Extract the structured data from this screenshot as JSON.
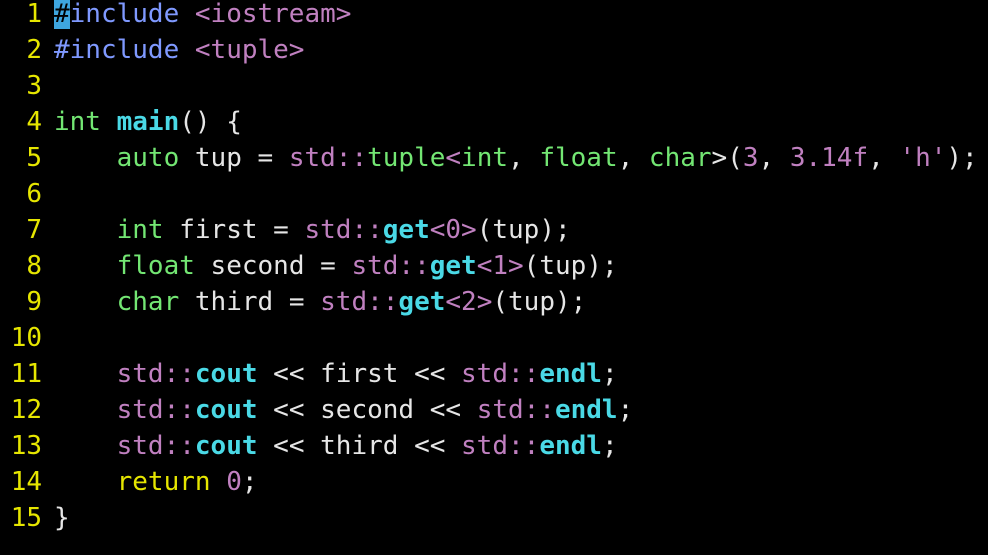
{
  "colors": {
    "background": "#000000",
    "line_number": "#e6e600",
    "text": "#e6e6e6",
    "preproc": "#7f99ff",
    "type": "#73e673",
    "keyword": "#e6e600",
    "func": "#4ad9e6",
    "namespace": "#c080c0",
    "string": "#c080c0",
    "number": "#c080c0",
    "cursor": "#3ea6df"
  },
  "editor": {
    "lines": [
      {
        "num": "1",
        "tokens": [
          {
            "t": "#",
            "k": "cursor"
          },
          {
            "t": "include",
            "k": "preproc"
          },
          {
            "t": " ",
            "k": "text"
          },
          {
            "t": "<iostream>",
            "k": "string"
          }
        ]
      },
      {
        "num": "2",
        "tokens": [
          {
            "t": "#include",
            "k": "preproc"
          },
          {
            "t": " ",
            "k": "text"
          },
          {
            "t": "<tuple>",
            "k": "string"
          }
        ]
      },
      {
        "num": "3",
        "tokens": []
      },
      {
        "num": "4",
        "tokens": [
          {
            "t": "int",
            "k": "type"
          },
          {
            "t": " ",
            "k": "text"
          },
          {
            "t": "main",
            "k": "func"
          },
          {
            "t": "() {",
            "k": "text"
          }
        ]
      },
      {
        "num": "5",
        "tokens": [
          {
            "t": "    ",
            "k": "text"
          },
          {
            "t": "auto",
            "k": "type"
          },
          {
            "t": " tup = ",
            "k": "text"
          },
          {
            "t": "std",
            "k": "namespace"
          },
          {
            "t": "::",
            "k": "namespace"
          },
          {
            "t": "tuple",
            "k": "type"
          },
          {
            "t": "<",
            "k": "namespace"
          },
          {
            "t": "int",
            "k": "type"
          },
          {
            "t": ", ",
            "k": "text"
          },
          {
            "t": "float",
            "k": "type"
          },
          {
            "t": ", ",
            "k": "text"
          },
          {
            "t": "char",
            "k": "type"
          },
          {
            "t": ">(",
            "k": "text"
          },
          {
            "t": "3",
            "k": "number"
          },
          {
            "t": ", ",
            "k": "text"
          },
          {
            "t": "3.14f",
            "k": "number"
          },
          {
            "t": ", ",
            "k": "text"
          },
          {
            "t": "'h'",
            "k": "string"
          },
          {
            "t": ");",
            "k": "text"
          }
        ]
      },
      {
        "num": "6",
        "tokens": []
      },
      {
        "num": "7",
        "tokens": [
          {
            "t": "    ",
            "k": "text"
          },
          {
            "t": "int",
            "k": "type"
          },
          {
            "t": " first = ",
            "k": "text"
          },
          {
            "t": "std",
            "k": "namespace"
          },
          {
            "t": "::",
            "k": "namespace"
          },
          {
            "t": "get",
            "k": "func"
          },
          {
            "t": "<",
            "k": "namespace"
          },
          {
            "t": "0",
            "k": "number"
          },
          {
            "t": ">",
            "k": "namespace"
          },
          {
            "t": "(tup);",
            "k": "text"
          }
        ]
      },
      {
        "num": "8",
        "tokens": [
          {
            "t": "    ",
            "k": "text"
          },
          {
            "t": "float",
            "k": "type"
          },
          {
            "t": " second = ",
            "k": "text"
          },
          {
            "t": "std",
            "k": "namespace"
          },
          {
            "t": "::",
            "k": "namespace"
          },
          {
            "t": "get",
            "k": "func"
          },
          {
            "t": "<",
            "k": "namespace"
          },
          {
            "t": "1",
            "k": "number"
          },
          {
            "t": ">",
            "k": "namespace"
          },
          {
            "t": "(tup);",
            "k": "text"
          }
        ]
      },
      {
        "num": "9",
        "tokens": [
          {
            "t": "    ",
            "k": "text"
          },
          {
            "t": "char",
            "k": "type"
          },
          {
            "t": " third = ",
            "k": "text"
          },
          {
            "t": "std",
            "k": "namespace"
          },
          {
            "t": "::",
            "k": "namespace"
          },
          {
            "t": "get",
            "k": "func"
          },
          {
            "t": "<",
            "k": "namespace"
          },
          {
            "t": "2",
            "k": "number"
          },
          {
            "t": ">",
            "k": "namespace"
          },
          {
            "t": "(tup);",
            "k": "text"
          }
        ]
      },
      {
        "num": "10",
        "tokens": []
      },
      {
        "num": "11",
        "tokens": [
          {
            "t": "    ",
            "k": "text"
          },
          {
            "t": "std",
            "k": "namespace"
          },
          {
            "t": "::",
            "k": "namespace"
          },
          {
            "t": "cout",
            "k": "func"
          },
          {
            "t": " << first << ",
            "k": "text"
          },
          {
            "t": "std",
            "k": "namespace"
          },
          {
            "t": "::",
            "k": "namespace"
          },
          {
            "t": "endl",
            "k": "func"
          },
          {
            "t": ";",
            "k": "text"
          }
        ]
      },
      {
        "num": "12",
        "tokens": [
          {
            "t": "    ",
            "k": "text"
          },
          {
            "t": "std",
            "k": "namespace"
          },
          {
            "t": "::",
            "k": "namespace"
          },
          {
            "t": "cout",
            "k": "func"
          },
          {
            "t": " << second << ",
            "k": "text"
          },
          {
            "t": "std",
            "k": "namespace"
          },
          {
            "t": "::",
            "k": "namespace"
          },
          {
            "t": "endl",
            "k": "func"
          },
          {
            "t": ";",
            "k": "text"
          }
        ]
      },
      {
        "num": "13",
        "tokens": [
          {
            "t": "    ",
            "k": "text"
          },
          {
            "t": "std",
            "k": "namespace"
          },
          {
            "t": "::",
            "k": "namespace"
          },
          {
            "t": "cout",
            "k": "func"
          },
          {
            "t": " << third << ",
            "k": "text"
          },
          {
            "t": "std",
            "k": "namespace"
          },
          {
            "t": "::",
            "k": "namespace"
          },
          {
            "t": "endl",
            "k": "func"
          },
          {
            "t": ";",
            "k": "text"
          }
        ]
      },
      {
        "num": "14",
        "tokens": [
          {
            "t": "    ",
            "k": "text"
          },
          {
            "t": "return",
            "k": "keyword"
          },
          {
            "t": " ",
            "k": "text"
          },
          {
            "t": "0",
            "k": "number"
          },
          {
            "t": ";",
            "k": "text"
          }
        ]
      },
      {
        "num": "15",
        "tokens": [
          {
            "t": "}",
            "k": "text"
          }
        ]
      }
    ]
  }
}
